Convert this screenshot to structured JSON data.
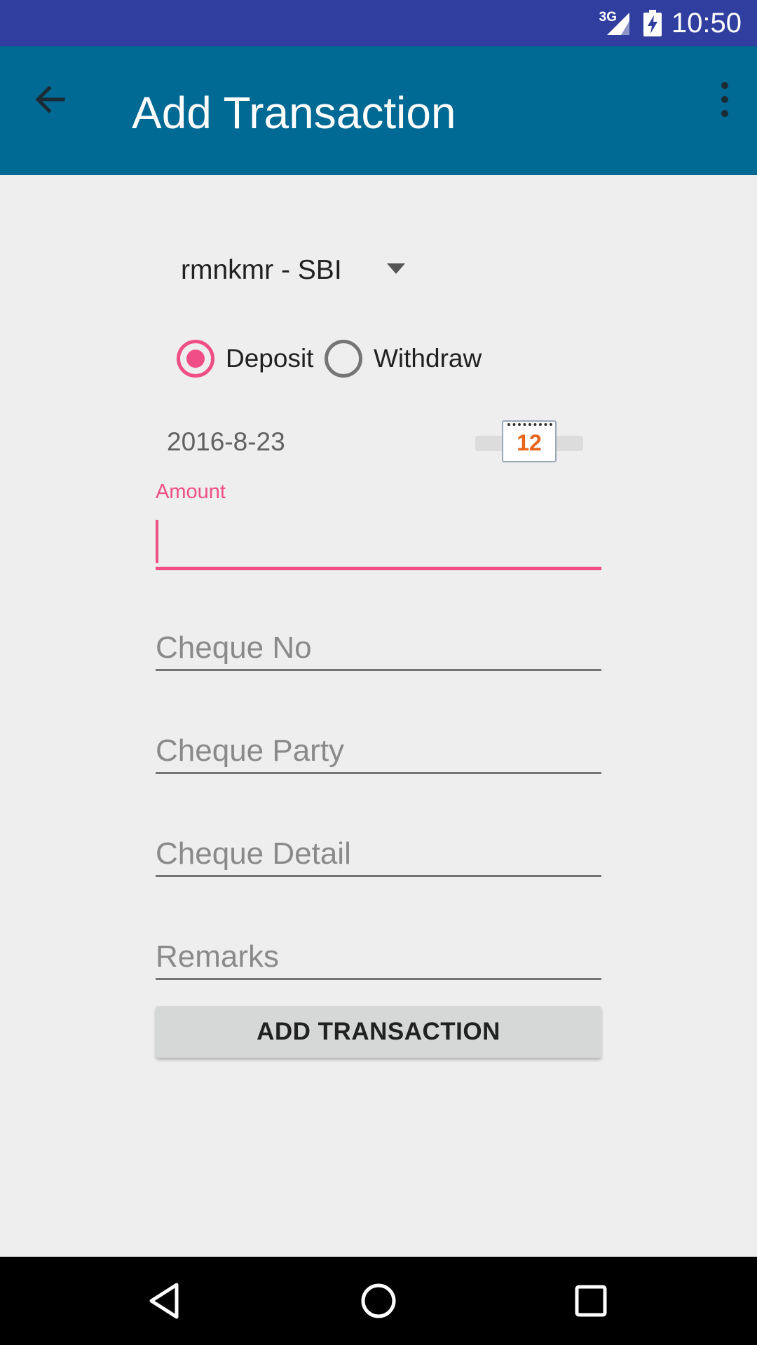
{
  "status_bar": {
    "network": "3G",
    "time": "10:50",
    "icons": [
      "signal-icon",
      "battery-charging-icon"
    ]
  },
  "app_bar": {
    "title": "Add Transaction",
    "back_icon": "arrow-back-icon",
    "overflow_icon": "more-vert-icon"
  },
  "account_spinner": {
    "selected": "rmnkmr - SBI"
  },
  "transaction_type": {
    "options": [
      {
        "label": "Deposit",
        "checked": true
      },
      {
        "label": "Withdraw",
        "checked": false
      }
    ]
  },
  "date": {
    "value": "2016-8-23",
    "calendar_icon_text": "12"
  },
  "amount": {
    "label": "Amount",
    "value": ""
  },
  "cheque_no": {
    "placeholder": "Cheque No"
  },
  "cheque_party": {
    "placeholder": "Cheque Party"
  },
  "cheque_detail": {
    "placeholder": "Cheque Detail"
  },
  "remarks": {
    "placeholder": "Remarks"
  },
  "submit": {
    "label": "ADD TRANSACTION"
  },
  "colors": {
    "status_bar": "#303f9f",
    "app_bar": "#006994",
    "accent": "#ef4f86",
    "background": "#eeeeee"
  }
}
